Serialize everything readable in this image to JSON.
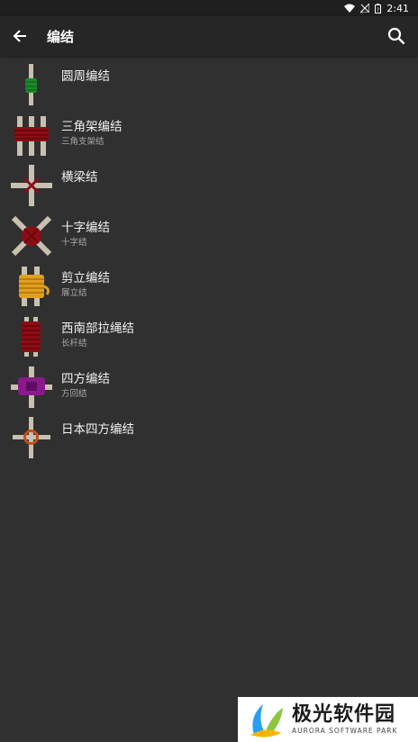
{
  "status": {
    "time": "2:41"
  },
  "appbar": {
    "title": "编结"
  },
  "items": [
    {
      "name": "圆周编结",
      "sub": ""
    },
    {
      "name": "三角架编结",
      "sub": "三角支架结"
    },
    {
      "name": "横梁结",
      "sub": ""
    },
    {
      "name": "十字编结",
      "sub": "十字结"
    },
    {
      "name": "剪立编结",
      "sub": "展立结"
    },
    {
      "name": "西南部拉绳结",
      "sub": "长杆结"
    },
    {
      "name": "四方编结",
      "sub": "方回结"
    },
    {
      "name": "日本四方编结",
      "sub": ""
    }
  ],
  "watermark": {
    "main": "极光软件园",
    "sub": "AURORA SOFTWARE PARK"
  },
  "colors": {
    "background": "#303030",
    "appbar": "#262626",
    "pole": "#c8c0b0"
  }
}
